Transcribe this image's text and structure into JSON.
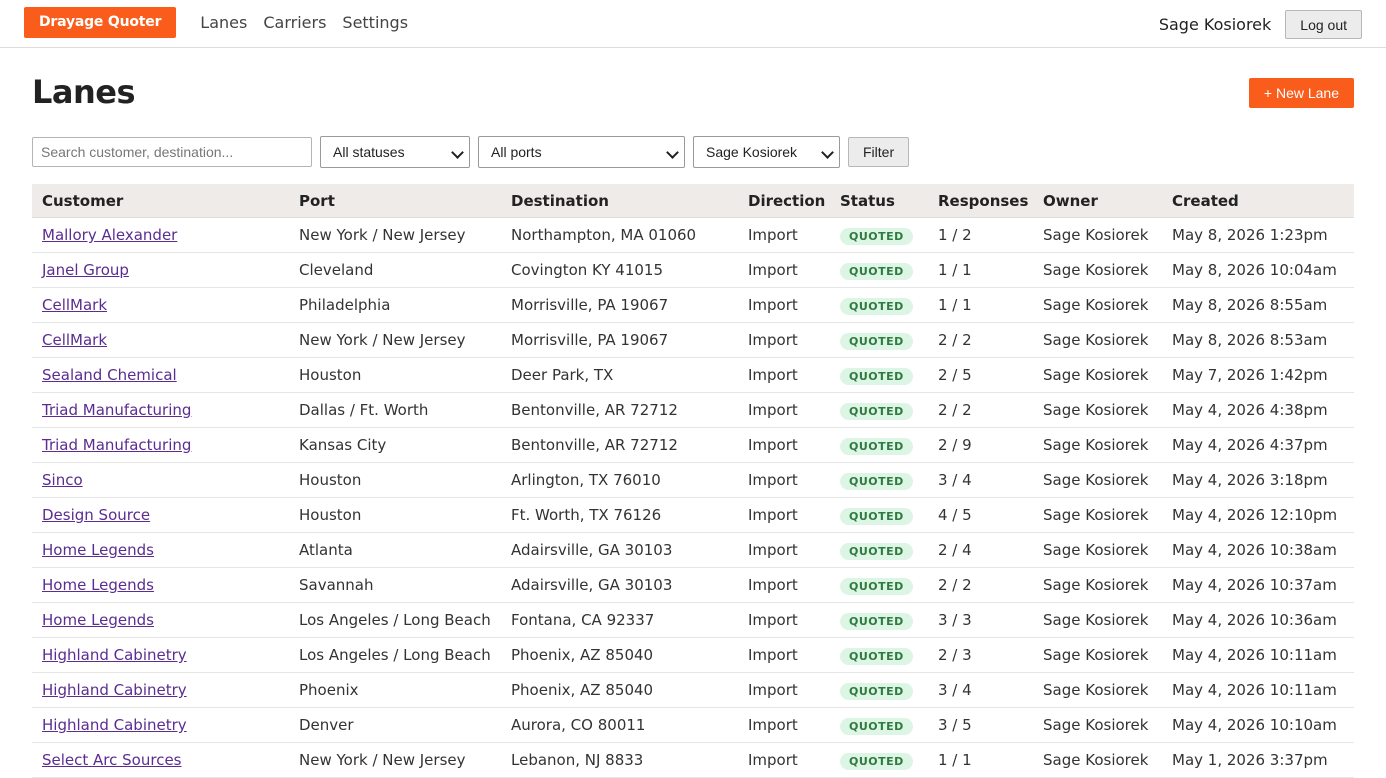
{
  "app": {
    "brand": "Drayage Quoter"
  },
  "nav": {
    "items": [
      "Lanes",
      "Carriers",
      "Settings"
    ]
  },
  "user": {
    "name": "Sage Kosiorek",
    "logout_label": "Log out"
  },
  "page": {
    "title": "Lanes",
    "new_button": "+ New Lane"
  },
  "filters": {
    "search_placeholder": "Search customer, destination...",
    "status_selected": "All statuses",
    "port_selected": "All ports",
    "owner_selected": "Sage Kosiorek",
    "filter_button": "Filter"
  },
  "colors": {
    "accent": "#fa5c1b",
    "badge_bg": "#dcf5e4",
    "badge_text": "#2f7a3f",
    "link": "#5b2c91"
  },
  "table": {
    "columns": [
      "Customer",
      "Port",
      "Destination",
      "Direction",
      "Status",
      "Responses",
      "Owner",
      "Created"
    ],
    "rows": [
      [
        "Mallory Alexander",
        "New York / New Jersey",
        "Northampton, MA 01060",
        "Import",
        "QUOTED",
        "1 / 2",
        "Sage Kosiorek",
        "May 8, 2026 1:23pm"
      ],
      [
        "Janel Group",
        "Cleveland",
        "Covington KY 41015",
        "Import",
        "QUOTED",
        "1 / 1",
        "Sage Kosiorek",
        "May 8, 2026 10:04am"
      ],
      [
        "CellMark",
        "Philadelphia",
        "Morrisville, PA 19067",
        "Import",
        "QUOTED",
        "1 / 1",
        "Sage Kosiorek",
        "May 8, 2026 8:55am"
      ],
      [
        "CellMark",
        "New York / New Jersey",
        "Morrisville, PA 19067",
        "Import",
        "QUOTED",
        "2 / 2",
        "Sage Kosiorek",
        "May 8, 2026 8:53am"
      ],
      [
        "Sealand Chemical",
        "Houston",
        "Deer Park, TX",
        "Import",
        "QUOTED",
        "2 / 5",
        "Sage Kosiorek",
        "May 7, 2026 1:42pm"
      ],
      [
        "Triad Manufacturing",
        "Dallas / Ft. Worth",
        "Bentonville, AR 72712",
        "Import",
        "QUOTED",
        "2 / 2",
        "Sage Kosiorek",
        "May 4, 2026 4:38pm"
      ],
      [
        "Triad Manufacturing",
        "Kansas City",
        "Bentonville, AR 72712",
        "Import",
        "QUOTED",
        "2 / 9",
        "Sage Kosiorek",
        "May 4, 2026 4:37pm"
      ],
      [
        "Sinco",
        "Houston",
        "Arlington, TX 76010",
        "Import",
        "QUOTED",
        "3 / 4",
        "Sage Kosiorek",
        "May 4, 2026 3:18pm"
      ],
      [
        "Design Source",
        "Houston",
        "Ft. Worth, TX 76126",
        "Import",
        "QUOTED",
        "4 / 5",
        "Sage Kosiorek",
        "May 4, 2026 12:10pm"
      ],
      [
        "Home Legends",
        "Atlanta",
        "Adairsville, GA 30103",
        "Import",
        "QUOTED",
        "2 / 4",
        "Sage Kosiorek",
        "May 4, 2026 10:38am"
      ],
      [
        "Home Legends",
        "Savannah",
        "Adairsville, GA 30103",
        "Import",
        "QUOTED",
        "2 / 2",
        "Sage Kosiorek",
        "May 4, 2026 10:37am"
      ],
      [
        "Home Legends",
        "Los Angeles / Long Beach",
        "Fontana, CA 92337",
        "Import",
        "QUOTED",
        "3 / 3",
        "Sage Kosiorek",
        "May 4, 2026 10:36am"
      ],
      [
        "Highland Cabinetry",
        "Los Angeles / Long Beach",
        "Phoenix, AZ 85040",
        "Import",
        "QUOTED",
        "2 / 3",
        "Sage Kosiorek",
        "May 4, 2026 10:11am"
      ],
      [
        "Highland Cabinetry",
        "Phoenix",
        "Phoenix, AZ 85040",
        "Import",
        "QUOTED",
        "3 / 4",
        "Sage Kosiorek",
        "May 4, 2026 10:11am"
      ],
      [
        "Highland Cabinetry",
        "Denver",
        "Aurora, CO 80011",
        "Import",
        "QUOTED",
        "3 / 5",
        "Sage Kosiorek",
        "May 4, 2026 10:10am"
      ],
      [
        "Select Arc Sources",
        "New York / New Jersey",
        "Lebanon, NJ 8833",
        "Import",
        "QUOTED",
        "1 / 1",
        "Sage Kosiorek",
        "May 1, 2026 3:37pm"
      ]
    ]
  }
}
